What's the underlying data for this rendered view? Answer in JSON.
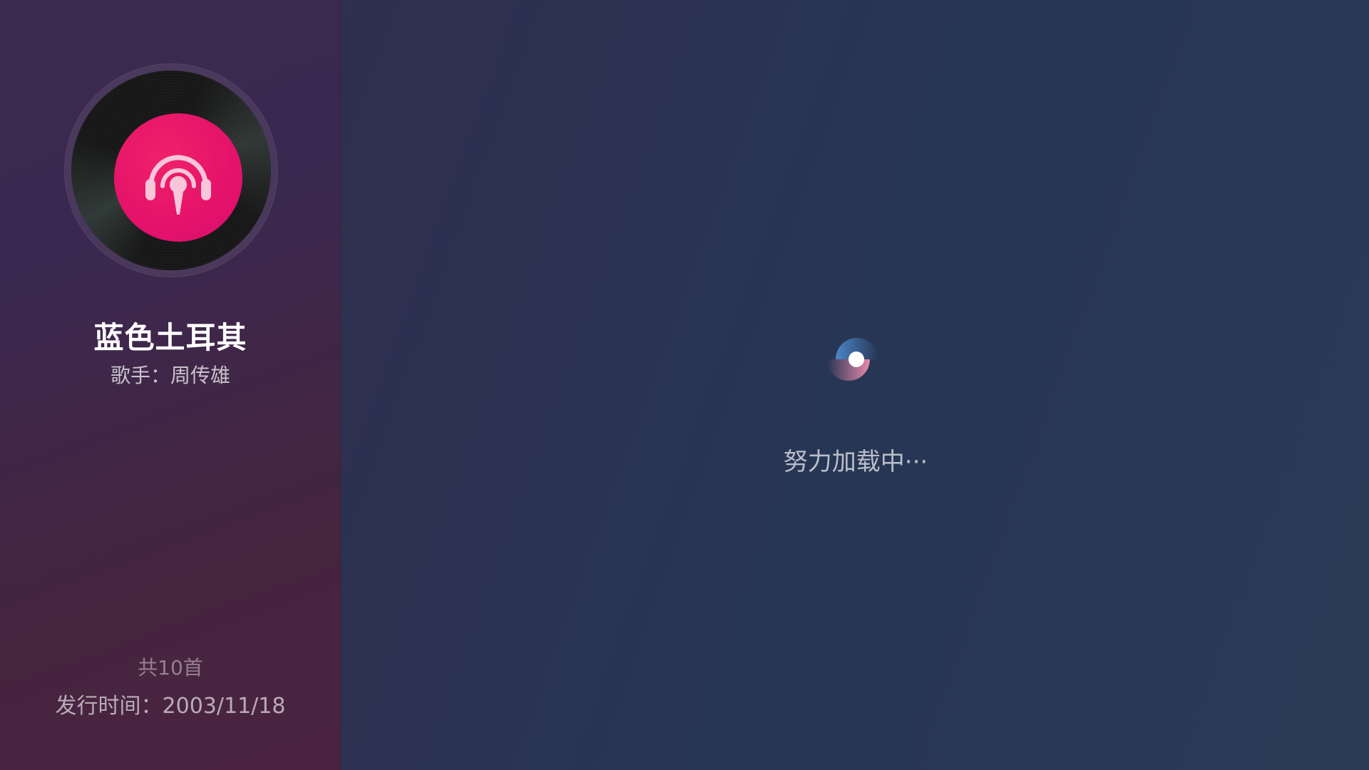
{
  "album": {
    "title": "蓝色土耳其",
    "singer_line": "歌手：周传雄",
    "track_count": "共10首",
    "release_line": "发行时间：2003/11/18",
    "cover_icon": "podcast-headphones-icon",
    "cover_color": "#e4126a"
  },
  "main": {
    "loading_text": "努力加载中···",
    "spinner_icon": "loading-spinner-icon"
  },
  "colors": {
    "accent": "#e4126a",
    "background": "#283655"
  }
}
